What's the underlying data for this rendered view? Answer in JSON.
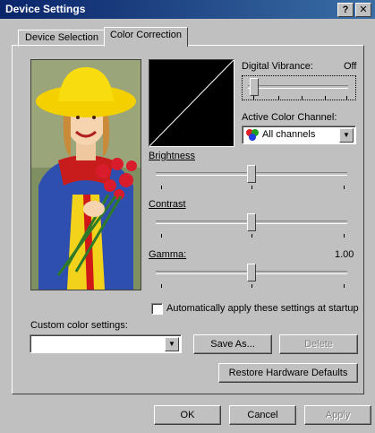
{
  "window": {
    "title": "Device Settings",
    "help_label": "?",
    "close_label": "✕"
  },
  "tabs": [
    {
      "label": "Device Selection",
      "active": false
    },
    {
      "label": "Color Correction",
      "active": true
    }
  ],
  "digital_vibrance": {
    "label": "Digital Vibrance:",
    "value": "Off",
    "level": 0
  },
  "active_channel": {
    "label": "Active Color Channel:",
    "selected": "All channels"
  },
  "brightness": {
    "label": "Brightness",
    "level": 0.5
  },
  "contrast": {
    "label": "Contrast",
    "level": 0.5
  },
  "gamma": {
    "label": "Gamma:",
    "value": "1.00",
    "level": 0.5
  },
  "auto_apply": {
    "label": "Automatically apply these settings at startup",
    "checked": false
  },
  "custom": {
    "label": "Custom color settings:",
    "value": ""
  },
  "buttons": {
    "save_as": "Save As...",
    "delete": "Delete",
    "restore": "Restore Hardware Defaults",
    "ok": "OK",
    "cancel": "Cancel",
    "apply": "Apply"
  },
  "colors": {
    "title_start": "#0a246a",
    "title_end": "#3a6ea5",
    "face": "#c0c0c0"
  }
}
